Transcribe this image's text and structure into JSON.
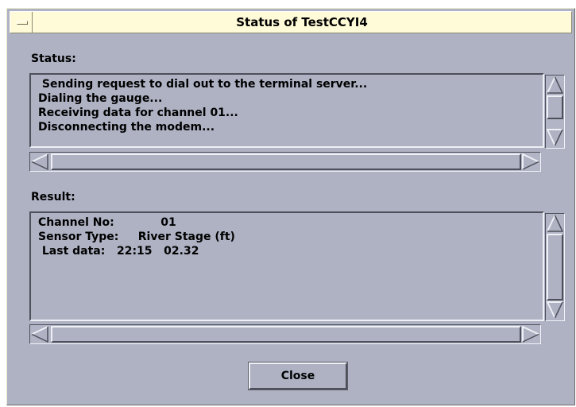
{
  "window": {
    "title": "Status of TestCCYI4"
  },
  "status": {
    "label": "Status:",
    "lines": [
      " Sending request to dial out to the terminal server...",
      "Dialing the gauge...",
      "Receiving data for channel 01...",
      "Disconnecting the modem..."
    ]
  },
  "result": {
    "label": "Result:",
    "lines": [
      "Channel No:            01",
      "Sensor Type:     River Stage (ft)",
      " Last data:   22:15   02.32"
    ]
  },
  "buttons": {
    "close_label": "Close"
  },
  "colors": {
    "window_bg": "#aeb2c3",
    "titlebar_bg": "#fffad7"
  },
  "icons": {
    "window_menu": "window-menu-icon",
    "up": "scroll-up-arrow-icon",
    "down": "scroll-down-arrow-icon",
    "left": "scroll-left-arrow-icon",
    "right": "scroll-right-arrow-icon"
  }
}
